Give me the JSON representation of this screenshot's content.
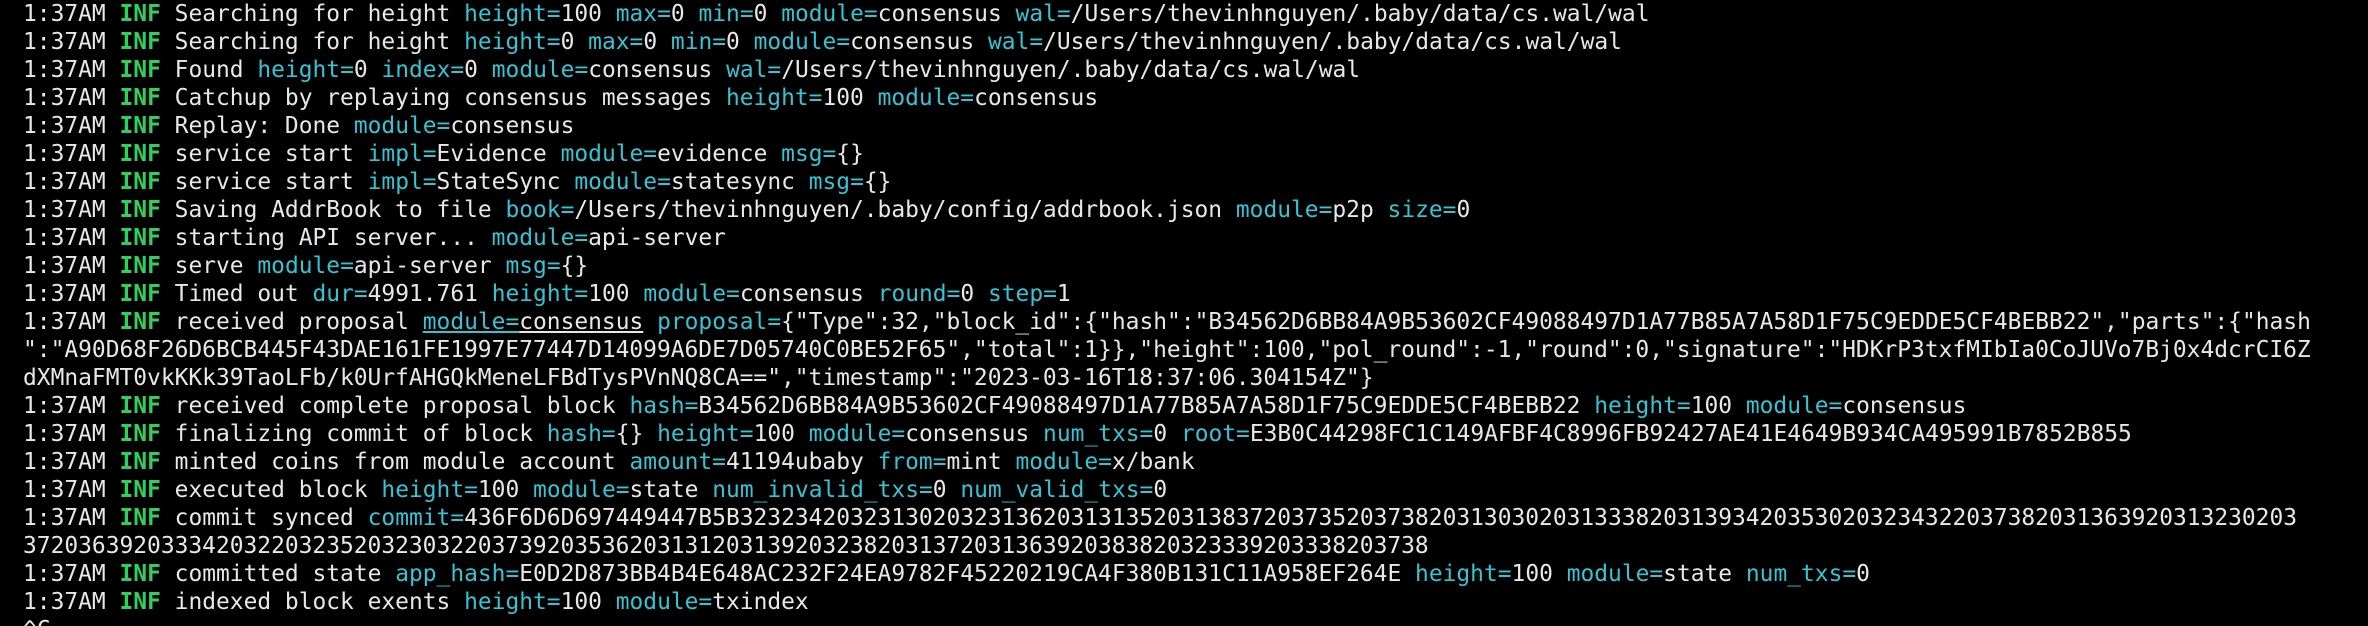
{
  "colors": {
    "background": "#000000",
    "text": "#e8e8e8",
    "level": "#2fd15b",
    "key": "#35c4d4"
  },
  "lines": [
    {
      "time": "1:37AM",
      "level": "INF",
      "msg": "Searching for height",
      "fields": [
        {
          "k": "height",
          "v": "100"
        },
        {
          "k": "max",
          "v": "0"
        },
        {
          "k": "min",
          "v": "0"
        },
        {
          "k": "module",
          "v": "consensus"
        },
        {
          "k": "wal",
          "v": "/Users/thevinhnguyen/.baby/data/cs.wal/wal"
        }
      ]
    },
    {
      "time": "1:37AM",
      "level": "INF",
      "msg": "Searching for height",
      "fields": [
        {
          "k": "height",
          "v": "0"
        },
        {
          "k": "max",
          "v": "0"
        },
        {
          "k": "min",
          "v": "0"
        },
        {
          "k": "module",
          "v": "consensus"
        },
        {
          "k": "wal",
          "v": "/Users/thevinhnguyen/.baby/data/cs.wal/wal"
        }
      ]
    },
    {
      "time": "1:37AM",
      "level": "INF",
      "msg": "Found",
      "fields": [
        {
          "k": "height",
          "v": "0"
        },
        {
          "k": "index",
          "v": "0"
        },
        {
          "k": "module",
          "v": "consensus"
        },
        {
          "k": "wal",
          "v": "/Users/thevinhnguyen/.baby/data/cs.wal/wal"
        }
      ]
    },
    {
      "time": "1:37AM",
      "level": "INF",
      "msg": "Catchup by replaying consensus messages",
      "fields": [
        {
          "k": "height",
          "v": "100"
        },
        {
          "k": "module",
          "v": "consensus"
        }
      ]
    },
    {
      "time": "1:37AM",
      "level": "INF",
      "msg": "Replay: Done",
      "fields": [
        {
          "k": "module",
          "v": "consensus"
        }
      ]
    },
    {
      "time": "1:37AM",
      "level": "INF",
      "msg": "service start",
      "fields": [
        {
          "k": "impl",
          "v": "Evidence"
        },
        {
          "k": "module",
          "v": "evidence"
        },
        {
          "k": "msg",
          "v": "{}"
        }
      ]
    },
    {
      "time": "1:37AM",
      "level": "INF",
      "msg": "service start",
      "fields": [
        {
          "k": "impl",
          "v": "StateSync"
        },
        {
          "k": "module",
          "v": "statesync"
        },
        {
          "k": "msg",
          "v": "{}"
        }
      ]
    },
    {
      "time": "1:37AM",
      "level": "INF",
      "msg": "Saving AddrBook to file",
      "fields": [
        {
          "k": "book",
          "v": "/Users/thevinhnguyen/.baby/config/addrbook.json"
        },
        {
          "k": "module",
          "v": "p2p"
        },
        {
          "k": "size",
          "v": "0"
        }
      ]
    },
    {
      "time": "1:37AM",
      "level": "INF",
      "msg": "starting API server...",
      "fields": [
        {
          "k": "module",
          "v": "api-server"
        }
      ]
    },
    {
      "time": "1:37AM",
      "level": "INF",
      "msg": "serve",
      "fields": [
        {
          "k": "module",
          "v": "api-server"
        },
        {
          "k": "msg",
          "v": "{}"
        }
      ]
    },
    {
      "time": "1:37AM",
      "level": "INF",
      "msg": "Timed out",
      "fields": [
        {
          "k": "dur",
          "v": "4991.761"
        },
        {
          "k": "height",
          "v": "100"
        },
        {
          "k": "module",
          "v": "consensus"
        },
        {
          "k": "round",
          "v": "0"
        },
        {
          "k": "step",
          "v": "1"
        }
      ]
    },
    {
      "time": "1:37AM",
      "level": "INF",
      "msg": "received proposal",
      "fields": [
        {
          "k": "module",
          "v": "consensus",
          "underline": true
        },
        {
          "k": "proposal",
          "v": "{\"Type\":32,\"block_id\":{\"hash\":\"B34562D6BB84A9B53602CF49088497D1A77B85A7A58D1F75C9EDDE5CF4BEBB22\",\"parts\":{\"hash"
        }
      ]
    },
    {
      "plain": "\":\"A90D68F26D6BCB445F43DAE161FE1997E77447D14099A6DE7D05740C0BE52F65\",\"total\":1}},\"height\":100,\"pol_round\":-1,\"round\":0,\"signature\":\"HDKrP3txfMIbIa0CoJUVo7Bj0x4dcrCI6Z"
    },
    {
      "plain": "dXMnaFMT0vkKKk39TaoLFb/k0UrfAHGQkMeneLFBdTysPVnNQ8CA==\",\"timestamp\":\"2023-03-16T18:37:06.304154Z\"}"
    },
    {
      "time": "1:37AM",
      "level": "INF",
      "msg": "received complete proposal block",
      "fields": [
        {
          "k": "hash",
          "v": "B34562D6BB84A9B53602CF49088497D1A77B85A7A58D1F75C9EDDE5CF4BEBB22"
        },
        {
          "k": "height",
          "v": "100"
        },
        {
          "k": "module",
          "v": "consensus"
        }
      ]
    },
    {
      "time": "1:37AM",
      "level": "INF",
      "msg": "finalizing commit of block",
      "fields": [
        {
          "k": "hash",
          "v": "{}"
        },
        {
          "k": "height",
          "v": "100"
        },
        {
          "k": "module",
          "v": "consensus"
        },
        {
          "k": "num_txs",
          "v": "0"
        },
        {
          "k": "root",
          "v": "E3B0C44298FC1C149AFBF4C8996FB92427AE41E4649B934CA495991B7852B855"
        }
      ]
    },
    {
      "time": "1:37AM",
      "level": "INF",
      "msg": "minted coins from module account",
      "fields": [
        {
          "k": "amount",
          "v": "41194ubaby"
        },
        {
          "k": "from",
          "v": "mint"
        },
        {
          "k": "module",
          "v": "x/bank"
        }
      ]
    },
    {
      "time": "1:37AM",
      "level": "INF",
      "msg": "executed block",
      "fields": [
        {
          "k": "height",
          "v": "100"
        },
        {
          "k": "module",
          "v": "state"
        },
        {
          "k": "num_invalid_txs",
          "v": "0"
        },
        {
          "k": "num_valid_txs",
          "v": "0"
        }
      ]
    },
    {
      "time": "1:37AM",
      "level": "INF",
      "msg": "commit synced",
      "fields": [
        {
          "k": "commit",
          "v": "436F6D6D697449447B5B32323420323130203231362031313520313837203735203738203130302031333820313934203530203234322037382031363920313230203"
        }
      ]
    },
    {
      "plain": "372036392033342032203235203230322037392035362031312031392032382031372031363920383820323339203338203738"
    },
    {
      "time": "1:37AM",
      "level": "INF",
      "msg": "committed state",
      "fields": [
        {
          "k": "app_hash",
          "v": "E0D2D873BB4B4E648AC232F24EA9782F45220219CA4F380B131C11A958EF264E"
        },
        {
          "k": "height",
          "v": "100"
        },
        {
          "k": "module",
          "v": "state"
        },
        {
          "k": "num_txs",
          "v": "0"
        }
      ]
    },
    {
      "time": "1:37AM",
      "level": "INF",
      "msg": "indexed block exents",
      "fields": [
        {
          "k": "height",
          "v": "100"
        },
        {
          "k": "module",
          "v": "txindex"
        }
      ]
    },
    {
      "plain": "^C"
    }
  ]
}
